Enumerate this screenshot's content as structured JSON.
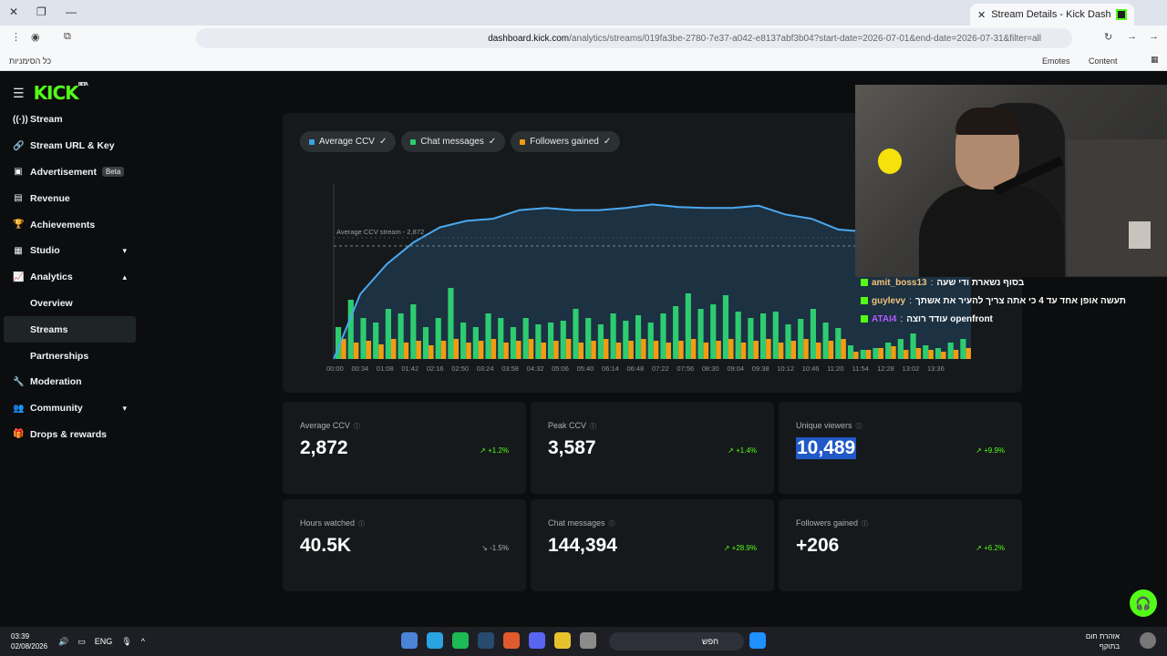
{
  "browser": {
    "tab_title": "Stream Details - Kick Dashboard",
    "url_host": "dashboard.kick.com",
    "url_path": "/analytics/streams/019fa3be-2780-7e37-a042-e8137abf3b04?start-date=2026-07-01&end-date=2026-07-31&filter=all",
    "bookmarks_all": "כל הסימניות",
    "bm_emotes": "Emotes",
    "bm_content": "Content"
  },
  "brand": {
    "logo": "KICK",
    "beta": "BETA"
  },
  "sidebar": {
    "items": [
      {
        "label": "Stream",
        "icon": "stream-icon"
      },
      {
        "label": "Stream URL & Key",
        "icon": "link-icon"
      },
      {
        "label": "Advertisement",
        "icon": "ad-icon",
        "badge": "Beta"
      },
      {
        "label": "Revenue",
        "icon": "revenue-icon"
      },
      {
        "label": "Achievements",
        "icon": "trophy-icon"
      },
      {
        "label": "Studio",
        "icon": "studio-icon"
      },
      {
        "label": "Analytics",
        "icon": "analytics-icon"
      },
      {
        "label": "Overview"
      },
      {
        "label": "Streams"
      },
      {
        "label": "Partnerships"
      },
      {
        "label": "Moderation",
        "icon": "wrench-icon"
      },
      {
        "label": "Community",
        "icon": "community-icon"
      },
      {
        "label": "Drops & rewards",
        "icon": "gift-icon"
      }
    ]
  },
  "chart": {
    "chips": [
      {
        "label": "Average CCV",
        "color": "#3ba0e6"
      },
      {
        "label": "Chat messages",
        "color": "#2ecc71"
      },
      {
        "label": "Followers gained",
        "color": "#f39c12"
      }
    ],
    "avg_line_label": "Average CCV stream - 2,872"
  },
  "chart_data": {
    "type": "line",
    "x": [
      "00:00",
      "00:34",
      "01:08",
      "01:42",
      "02:16",
      "02:50",
      "03:24",
      "03:58",
      "04:32",
      "05:06",
      "05:40",
      "06:14",
      "06:48",
      "07:22",
      "07:56",
      "08:30",
      "09:04",
      "09:38",
      "10:12",
      "10:46",
      "11:20",
      "11:54",
      "12:28",
      "13:02",
      "13:36"
    ],
    "series": [
      {
        "name": "Average CCV",
        "values": [
          0,
          1500,
          2200,
          2700,
          3050,
          3200,
          3250,
          3450,
          3500,
          3450,
          3450,
          3500,
          3580,
          3520,
          3500,
          3500,
          3550,
          3350,
          3250,
          3000,
          2950,
          2900,
          2850,
          2800,
          2780
        ]
      }
    ],
    "bars_chat": [
      35,
      65,
      45,
      40,
      55,
      50,
      60,
      35,
      45,
      78,
      40,
      35,
      50,
      45,
      35,
      45,
      38,
      40,
      42,
      55,
      45,
      38,
      50,
      42,
      48,
      40,
      50,
      58,
      72,
      55,
      60,
      70,
      52,
      45,
      50,
      52,
      38,
      44,
      55,
      40,
      34,
      15,
      10,
      12,
      18,
      22,
      28,
      15,
      12,
      18,
      22
    ],
    "bars_followers": [
      22,
      18,
      20,
      16,
      22,
      18,
      20,
      15,
      20,
      22,
      18,
      20,
      22,
      18,
      20,
      22,
      18,
      20,
      22,
      18,
      20,
      22,
      18,
      20,
      22,
      20,
      18,
      20,
      22,
      18,
      20,
      22,
      18,
      20,
      22,
      18,
      20,
      22,
      18,
      20,
      22,
      8,
      10,
      12,
      14,
      10,
      12,
      10,
      8,
      10,
      12
    ],
    "average_line": 2872,
    "ylim": [
      0,
      3800
    ]
  },
  "stats": [
    {
      "label": "Average CCV",
      "value": "2,872",
      "change": "+1.2%"
    },
    {
      "label": "Peak CCV",
      "value": "3,587",
      "change": "+1.4%"
    },
    {
      "label": "Unique viewers",
      "value": "10,489",
      "change": "+9.9%"
    },
    {
      "label": "Hours watched",
      "value": "40.5K",
      "change": "-1.5%"
    },
    {
      "label": "Chat messages",
      "value": "144,394",
      "change": "+28.9%"
    },
    {
      "label": "Followers gained",
      "value": "+206",
      "change": "+6.2%"
    }
  ],
  "chat": [
    {
      "user": "amit_boss13",
      "msg": "בסוף נשארת ודי שעה"
    },
    {
      "user": "guylevy",
      "msg": "תעשה אופן אחד עד 4 כי אתה צריך להעיר את אשתך"
    },
    {
      "user": "ATAI4",
      "msg": "עודד רוצה openfront"
    }
  ],
  "taskbar": {
    "time": "03:39",
    "date": "02/08/2026",
    "lang": "ENG",
    "search": "חפש",
    "weather_line1": "אזהרת חום",
    "weather_line2": "בתוקף"
  }
}
